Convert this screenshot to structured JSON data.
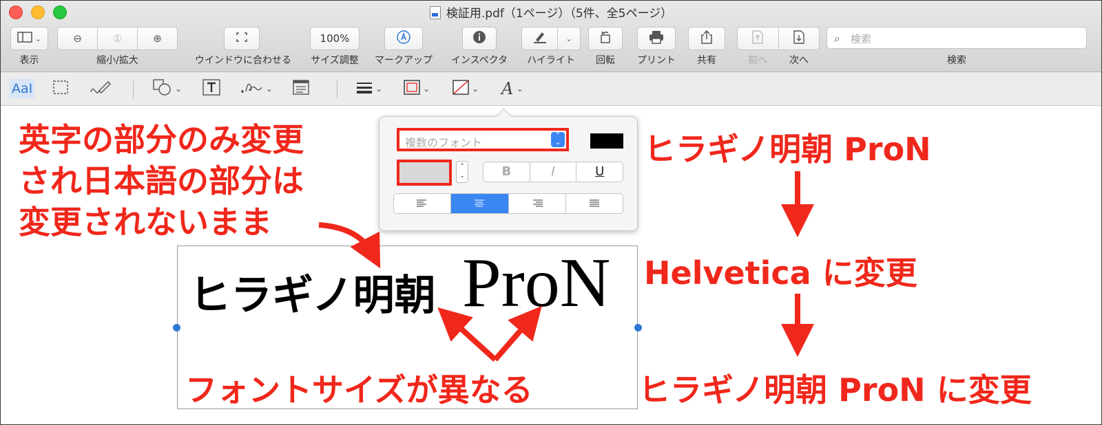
{
  "window": {
    "title": "検証用.pdf（1ページ）（5件、全5ページ）"
  },
  "toolbar": {
    "view_label": "表示",
    "zoom_label": "縮小/拡大",
    "fit_label": "ウインドウに合わせる",
    "size_value": "100%",
    "size_label": "サイズ調整",
    "markup_label": "マークアップ",
    "inspector_label": "インスペクタ",
    "highlight_label": "ハイライト",
    "rotate_label": "回転",
    "print_label": "プリント",
    "share_label": "共有",
    "prev_label": "前へ",
    "next_label": "次へ",
    "search_label": "検索",
    "search_placeholder": "検索"
  },
  "markup_bar": {
    "text_tool": "AaI"
  },
  "font_popup": {
    "font_placeholder": "複数のフォント",
    "bold": "B",
    "italic": "I",
    "underline": "U",
    "text_color": "#000000",
    "selected_alignment": "center"
  },
  "document": {
    "text_jp": "ヒラギノ明朝",
    "text_en": "ProN"
  },
  "annotations": {
    "left_note": [
      "英字の部分のみ変更",
      "され日本語の部分は",
      "変更されないまま"
    ],
    "right_step1": "ヒラギノ明朝 ProN",
    "right_step2": "Helvetica に変更",
    "right_step3": "ヒラギノ明朝 ProN に変更",
    "bottom_note": "フォントサイズが異なる",
    "accent_color": "#f0271b"
  }
}
